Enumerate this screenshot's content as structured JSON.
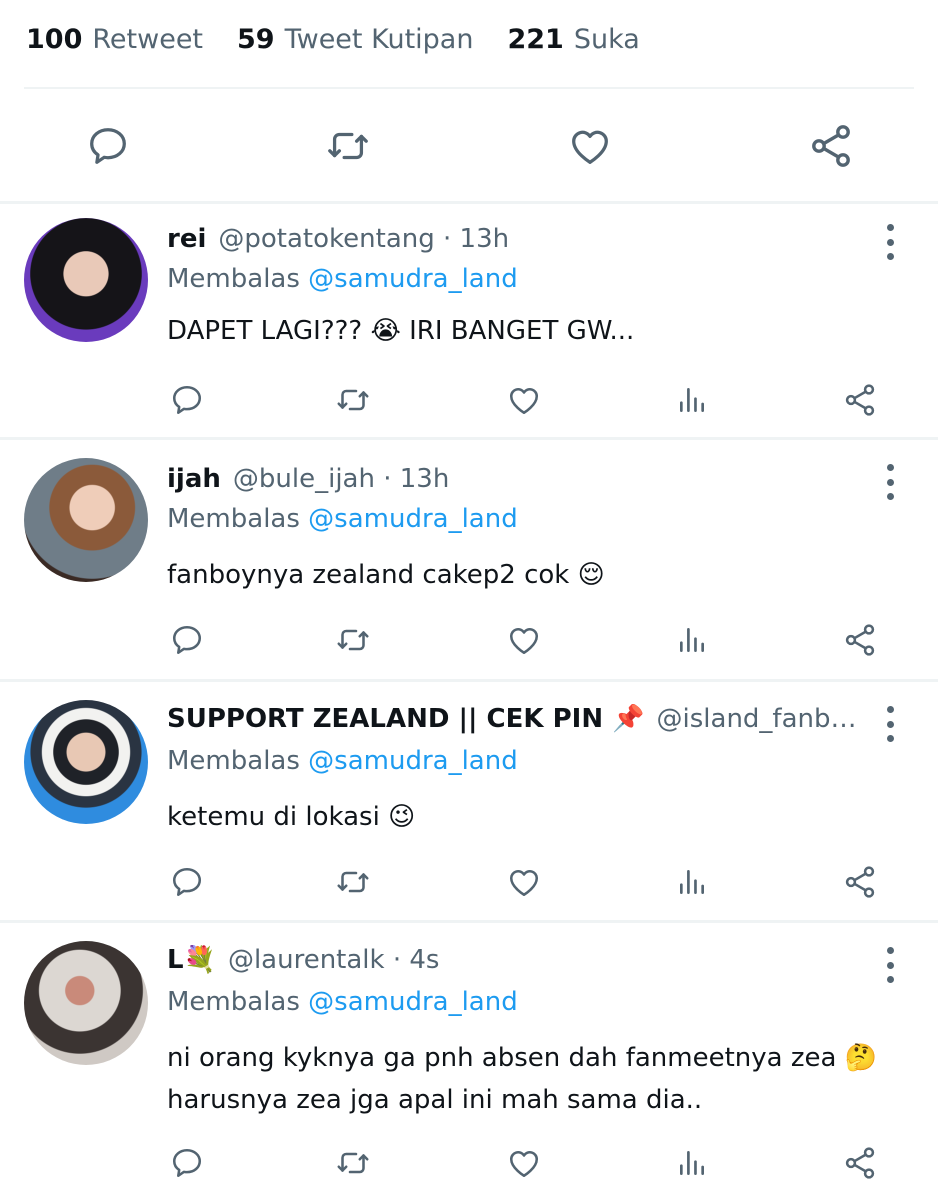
{
  "stats": {
    "retweet_count": "100",
    "retweet_label": "Retweet",
    "quote_count": "59",
    "quote_label": "Tweet Kutipan",
    "like_count": "221",
    "like_label": "Suka"
  },
  "colors": {
    "text": "#0f1419",
    "muted": "#536471",
    "link": "#1d9bf0",
    "divider": "#eff3f4"
  },
  "icons": [
    "reply-icon",
    "retweet-icon",
    "like-icon",
    "analytics-icon",
    "share-icon",
    "more-icon"
  ],
  "replies": [
    {
      "name": "rei",
      "meta": "@potatokentang · 13h",
      "replying_label": "Membalas",
      "replying_to": "@samudra_land",
      "text": "DAPET LAGI??? 😭 IRI BANGET GW..."
    },
    {
      "name": "ijah",
      "meta": "@bule_ijah · 13h",
      "replying_label": "Membalas",
      "replying_to": "@samudra_land",
      "text": "fanboynya zealand cakep2 cok 😌"
    },
    {
      "name": "SUPPORT ZEALAND || CEK PIN 📌",
      "meta": "@island_fanba...",
      "replying_label": "Membalas",
      "replying_to": "@samudra_land",
      "text": "ketemu di lokasi 😉"
    },
    {
      "name": "L💐",
      "meta": "@laurentalk · 4s",
      "replying_label": "Membalas",
      "replying_to": "@samudra_land",
      "text": "ni orang kyknya ga pnh absen dah fanmeetnya zea 🤔",
      "text2": "harusnya zea jga apal ini mah sama dia.."
    }
  ]
}
